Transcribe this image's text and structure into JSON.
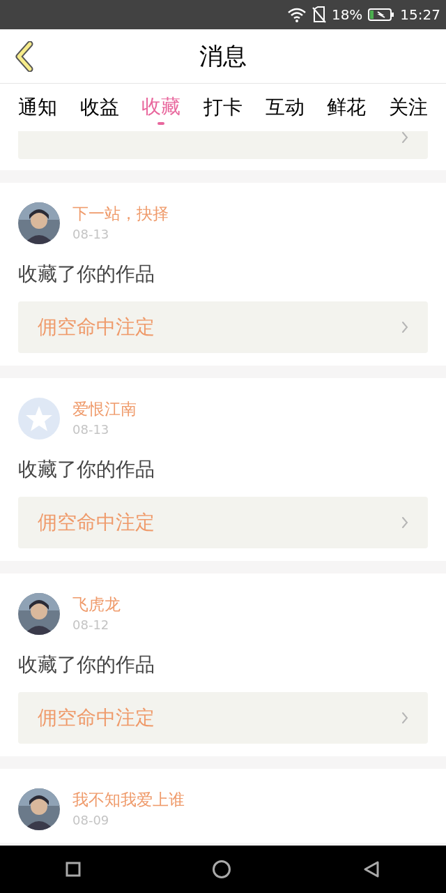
{
  "status_bar": {
    "battery": "18%",
    "time": "15:27"
  },
  "header": {
    "title": "消息"
  },
  "tabs": [
    {
      "label": "通知",
      "selected": false
    },
    {
      "label": "收益",
      "selected": false
    },
    {
      "label": "收藏",
      "selected": true
    },
    {
      "label": "打卡",
      "selected": false
    },
    {
      "label": "互动",
      "selected": false
    },
    {
      "label": "鲜花",
      "selected": false
    },
    {
      "label": "关注",
      "selected": false
    }
  ],
  "messages": [
    {
      "user": "下一站，抉择",
      "date": "08-13",
      "kind": "picture",
      "action": "收藏了你的作品",
      "work": "佣空命中注定"
    },
    {
      "user": "爱恨江南",
      "date": "08-13",
      "kind": "default",
      "action": "收藏了你的作品",
      "work": "佣空命中注定"
    },
    {
      "user": "飞虎龙",
      "date": "08-12",
      "kind": "picture",
      "action": "收藏了你的作品",
      "work": "佣空命中注定"
    },
    {
      "user": "我不知我爱上谁",
      "date": "08-09",
      "kind": "picture"
    }
  ]
}
